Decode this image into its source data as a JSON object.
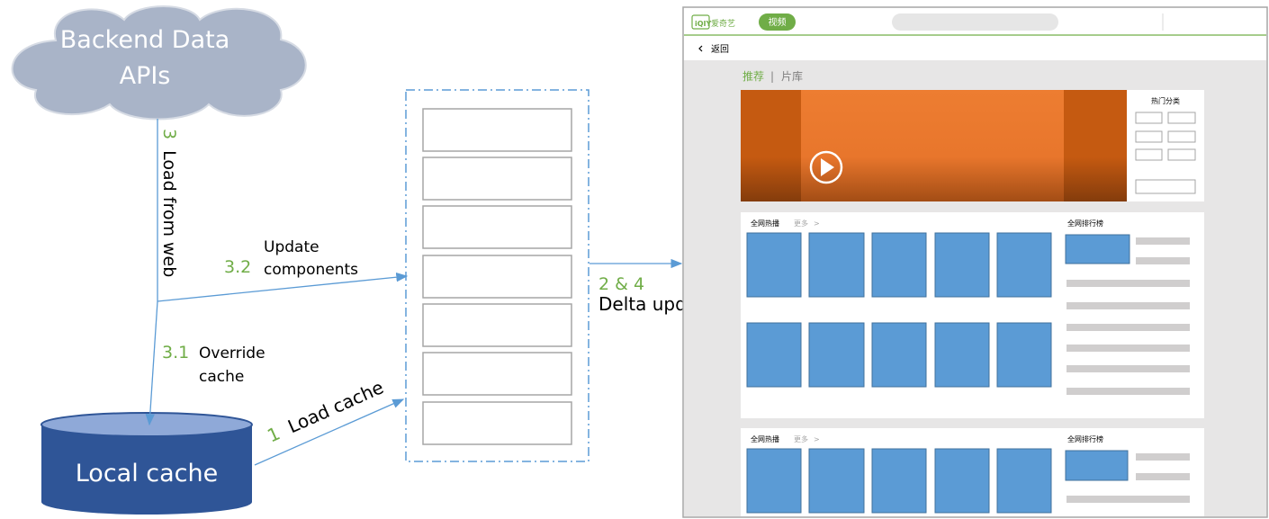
{
  "cloud": {
    "line1": "Backend Data",
    "line2": "APIs"
  },
  "cache": {
    "label": "Local cache"
  },
  "steps": {
    "load_from_web": {
      "num": "3",
      "text": "Load from web"
    },
    "update_components": {
      "num": "3.2",
      "line1": "Update",
      "line2": "components"
    },
    "override_cache": {
      "num": "3.1",
      "line1": "Override",
      "line2": "cache"
    },
    "load_cache": {
      "num": "1",
      "text": "Load cache"
    },
    "delta_update": {
      "num": "2 & 4",
      "text": "Delta update"
    }
  },
  "app": {
    "logo_text": "爱奇艺",
    "header_tab": "视频",
    "back_label": "返回",
    "back_icon": "chevron-left-icon",
    "nav": {
      "active": "推荐",
      "separator": "|",
      "other": "片库"
    },
    "banner": {
      "play_icon": "play-icon",
      "side_title": "热门分类"
    },
    "section1": {
      "title": "全网热播",
      "more": "更多",
      "more_icon": ">",
      "ranking": "全网排行榜"
    },
    "section2": {
      "title": "全网热播",
      "more": "更多",
      "more_icon": ">",
      "ranking": "全网排行榜"
    }
  },
  "colors": {
    "green": "#70ad47",
    "arrow": "#5b9bd5",
    "cloud": "#a9b4c8",
    "cache": "#2f5597",
    "tile": "#5b9bd5",
    "banner": "#ed7d31"
  }
}
